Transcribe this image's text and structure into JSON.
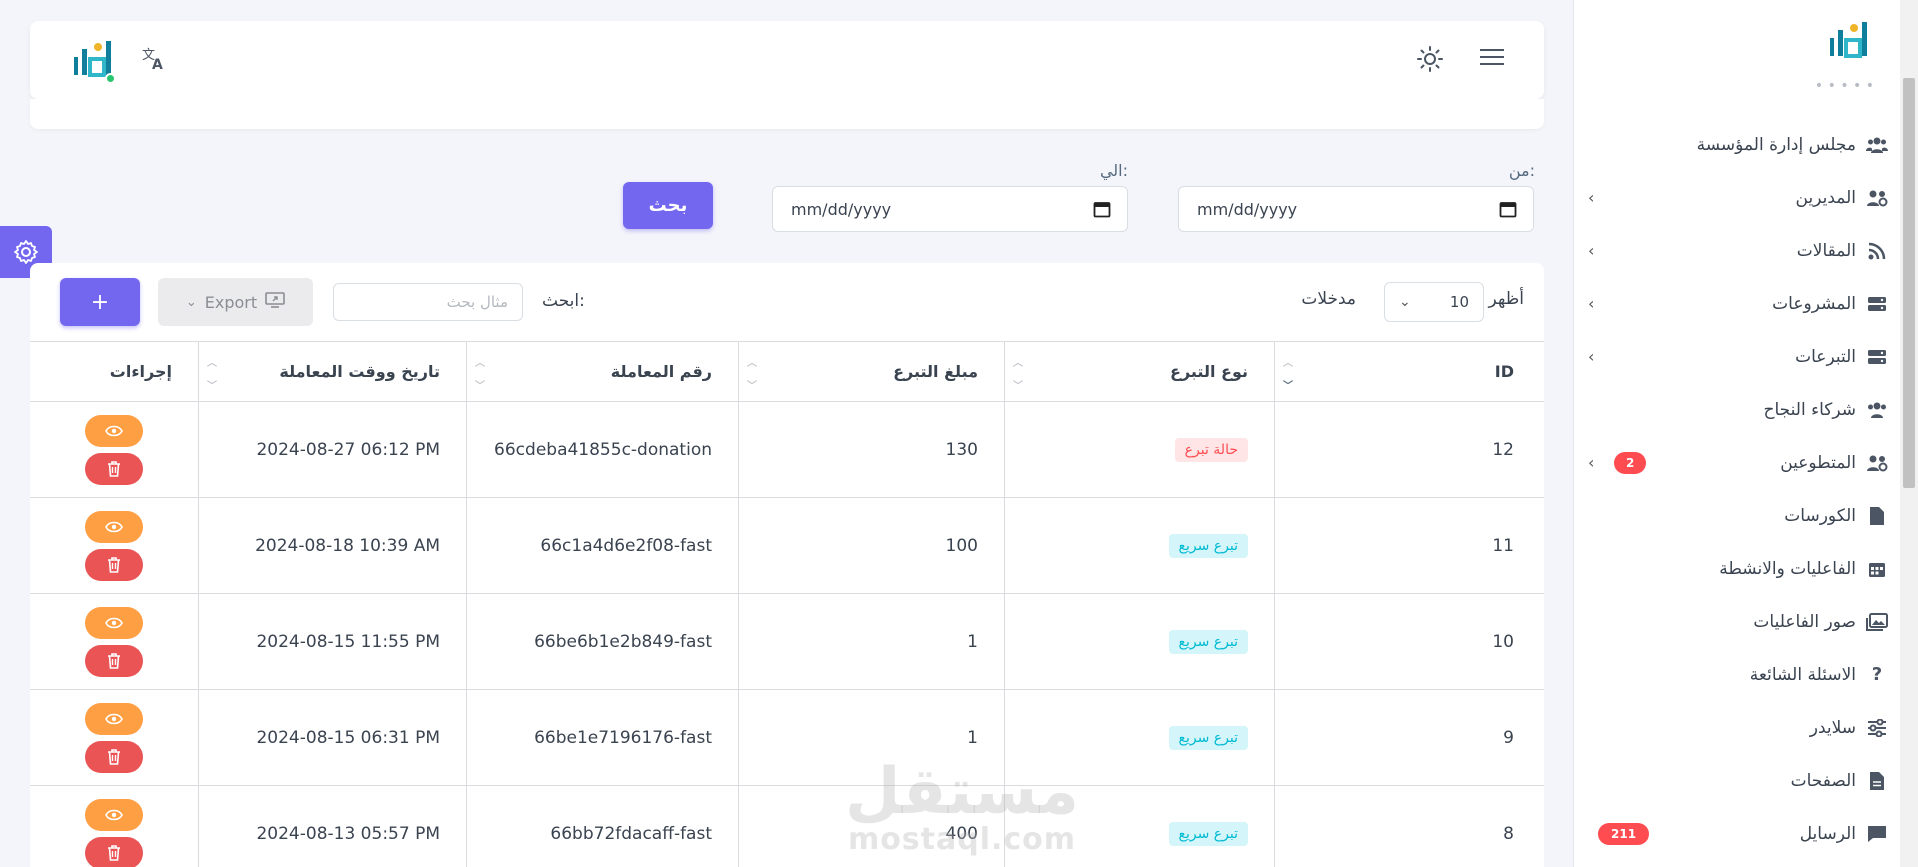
{
  "sidebar": {
    "items": [
      {
        "label": "مجلس إدارة المؤسسة",
        "icon": "users-icon",
        "chevron": false
      },
      {
        "label": "المديرين",
        "icon": "users-gear-icon",
        "chevron": true
      },
      {
        "label": "المقالات",
        "icon": "rss-icon",
        "chevron": true
      },
      {
        "label": "المشروعات",
        "icon": "server-icon",
        "chevron": true
      },
      {
        "label": "التبرعات",
        "icon": "server-icon",
        "chevron": true
      },
      {
        "label": "شركاء النجاح",
        "icon": "users-icon",
        "chevron": false
      },
      {
        "label": "المتطوعين",
        "icon": "users-gear-icon",
        "chevron": true,
        "badge": "2"
      },
      {
        "label": "الكورسات",
        "icon": "file-icon",
        "chevron": false
      },
      {
        "label": "الفاعليات والانشطة",
        "icon": "calendar-icon",
        "chevron": false
      },
      {
        "label": "صور الفاعليات",
        "icon": "images-icon",
        "chevron": false
      },
      {
        "label": "الاسئلة الشائعة",
        "icon": "question-icon",
        "chevron": false
      },
      {
        "label": "سلايدر",
        "icon": "sliders-icon",
        "chevron": false
      },
      {
        "label": "الصفحات",
        "icon": "file-icon",
        "chevron": false
      },
      {
        "label": "الرسايل",
        "icon": "message-icon",
        "chevron": false,
        "badge": "211"
      }
    ]
  },
  "filter": {
    "from_label": "من:",
    "to_label": "الي:",
    "from_placeholder": "mm/dd/yyyy",
    "to_placeholder": "mm/dd/yyyy",
    "search_button": "بحث"
  },
  "table_controls": {
    "show_label": "أظهر",
    "page_length": "10",
    "entries_label": "مدخلات",
    "search_label": "ابحث:",
    "search_placeholder": "مثال بحث",
    "export_label": "Export",
    "add_label": "+"
  },
  "table": {
    "headers": {
      "id": "ID",
      "type": "نوع التبرع",
      "amount": "مبلغ التبرع",
      "txn": "رقم المعاملة",
      "date": "تاريخ ووقت المعاملة",
      "actions": "إجراءات"
    },
    "rows": [
      {
        "id": "12",
        "type": "حالة تبرع",
        "type_style": "red",
        "amount": "130",
        "txn": "66cdeba41855c-donation",
        "date": "2024-08-27 06:12 PM"
      },
      {
        "id": "11",
        "type": "تبرع سريع",
        "type_style": "cyan",
        "amount": "100",
        "txn": "66c1a4d6e2f08-fast",
        "date": "2024-08-18 10:39 AM"
      },
      {
        "id": "10",
        "type": "تبرع سريع",
        "type_style": "cyan",
        "amount": "1",
        "txn": "66be6b1e2b849-fast",
        "date": "2024-08-15 11:55 PM"
      },
      {
        "id": "9",
        "type": "تبرع سريع",
        "type_style": "cyan",
        "amount": "1",
        "txn": "66be1e7196176-fast",
        "date": "2024-08-15 06:31 PM"
      },
      {
        "id": "8",
        "type": "تبرع سريع",
        "type_style": "cyan",
        "amount": "400",
        "txn": "66bb72fdacaff-fast",
        "date": "2024-08-13 05:57 PM"
      }
    ]
  },
  "watermark": {
    "line1": "مستقل",
    "line2": "mostaql.com"
  },
  "colors": {
    "primary": "#7367f0",
    "orange": "#ff9f43",
    "danger": "#ea5455",
    "cyan": "#00bad1"
  }
}
